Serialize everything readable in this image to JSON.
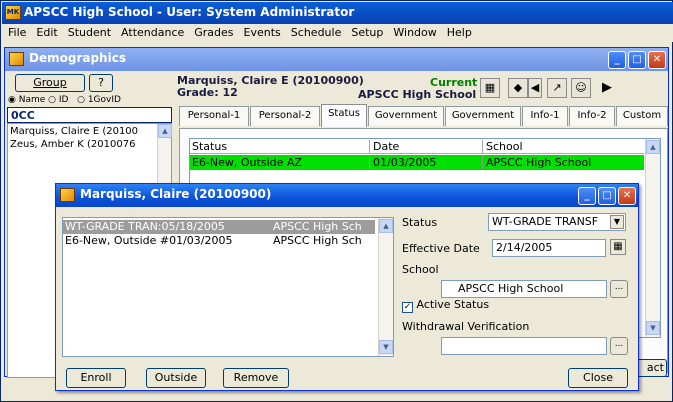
{
  "app": {
    "title": "APSCC High School - User: System Administrator",
    "icon_text": "MK"
  },
  "menu": [
    "File",
    "Edit",
    "Student",
    "Attendance",
    "Grades",
    "Events",
    "Schedule",
    "Setup",
    "Window",
    "Help"
  ],
  "demographics": {
    "title": "Demographics",
    "group_label": "Group",
    "help_label": "?",
    "radio_name": "Name",
    "radio_id": "ID",
    "radio_govid": "1GovID",
    "filter_text": "0CC",
    "students": [
      "Marquiss, Claire E (20100",
      "Zeus, Amber K (2010076"
    ],
    "student_name": "Marquiss, Claire E (20100900)",
    "grade": "Grade: 12",
    "current_label": "Current",
    "school_name": "APSCC High School",
    "tabs": [
      "Personal-1",
      "Personal-2",
      "Status",
      "Government",
      "Government",
      "Info-1",
      "Info-2",
      "Custom"
    ],
    "status_grid": {
      "headers": [
        "Status",
        "Date",
        "School"
      ],
      "rows": [
        [
          "E6-New, Outside AZ",
          "01/03/2005",
          "APSCC High School"
        ]
      ]
    },
    "contact_btn": "act"
  },
  "dialog": {
    "title": "Marquiss, Claire (20100900)",
    "list": [
      {
        "status": "WT-GRADE TRAN:05/18/2005",
        "school": "APSCC High Sch"
      },
      {
        "status": "E6-New, Outside #01/03/2005",
        "school": "APSCC High Sch"
      }
    ],
    "status_label": "Status",
    "status_value": "WT-GRADE TRANSF",
    "effective_date_label": "Effective Date",
    "effective_date_value": "2/14/2005",
    "school_label": "School",
    "school_value": "APSCC High School",
    "active_status_label": "Active Status",
    "active_checked": true,
    "withdrawal_label": "Withdrawal Verification",
    "withdrawal_value": "",
    "buttons": {
      "enroll": "Enroll",
      "outside": "Outside",
      "remove": "Remove",
      "close": "Close"
    },
    "ellipsis": "..."
  },
  "colors": {
    "selected_row": "#00e000",
    "list_selected": "#9c9c9c",
    "titlebar": "#0a52d9"
  }
}
